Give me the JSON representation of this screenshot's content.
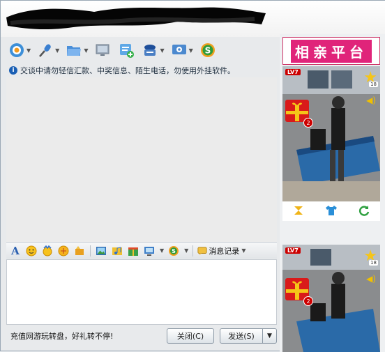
{
  "toolbar": {
    "items": [
      {
        "name": "video-call",
        "icon": "webcam-icon",
        "has_dropdown": true
      },
      {
        "name": "voice-call",
        "icon": "microphone-icon",
        "has_dropdown": true
      },
      {
        "name": "send-file",
        "icon": "folder-icon",
        "has_dropdown": true
      },
      {
        "name": "remote-assist",
        "icon": "screen-share-icon",
        "has_dropdown": false
      },
      {
        "name": "create-discussion",
        "icon": "add-group-icon",
        "has_dropdown": false
      },
      {
        "name": "app",
        "icon": "user-card-icon",
        "has_dropdown": true
      },
      {
        "name": "settings",
        "icon": "monitor-settings-icon",
        "has_dropdown": true
      },
      {
        "name": "soso",
        "icon": "soso-s-icon",
        "has_dropdown": false
      }
    ]
  },
  "notice": {
    "text": "交谈中请勿轻信汇款、中奖信息、陌生电话，勿使用外挂软件。"
  },
  "format_bar": {
    "history_label": "消息记录"
  },
  "bottom": {
    "promo_text": "充值网游玩转盘，好礼转不停!",
    "close_label": "关闭(C)",
    "send_label": "发送(S)"
  },
  "sidebar": {
    "ad_text": "相亲平台",
    "video1": {
      "level_badge": "LV7",
      "star_count": "18",
      "gift_count": "2"
    },
    "video2": {
      "level_badge": "LV7",
      "star_count": "18",
      "gift_count": "2"
    }
  },
  "colors": {
    "accent": "#1a5fb4",
    "ad_pink": "#e0247a"
  }
}
